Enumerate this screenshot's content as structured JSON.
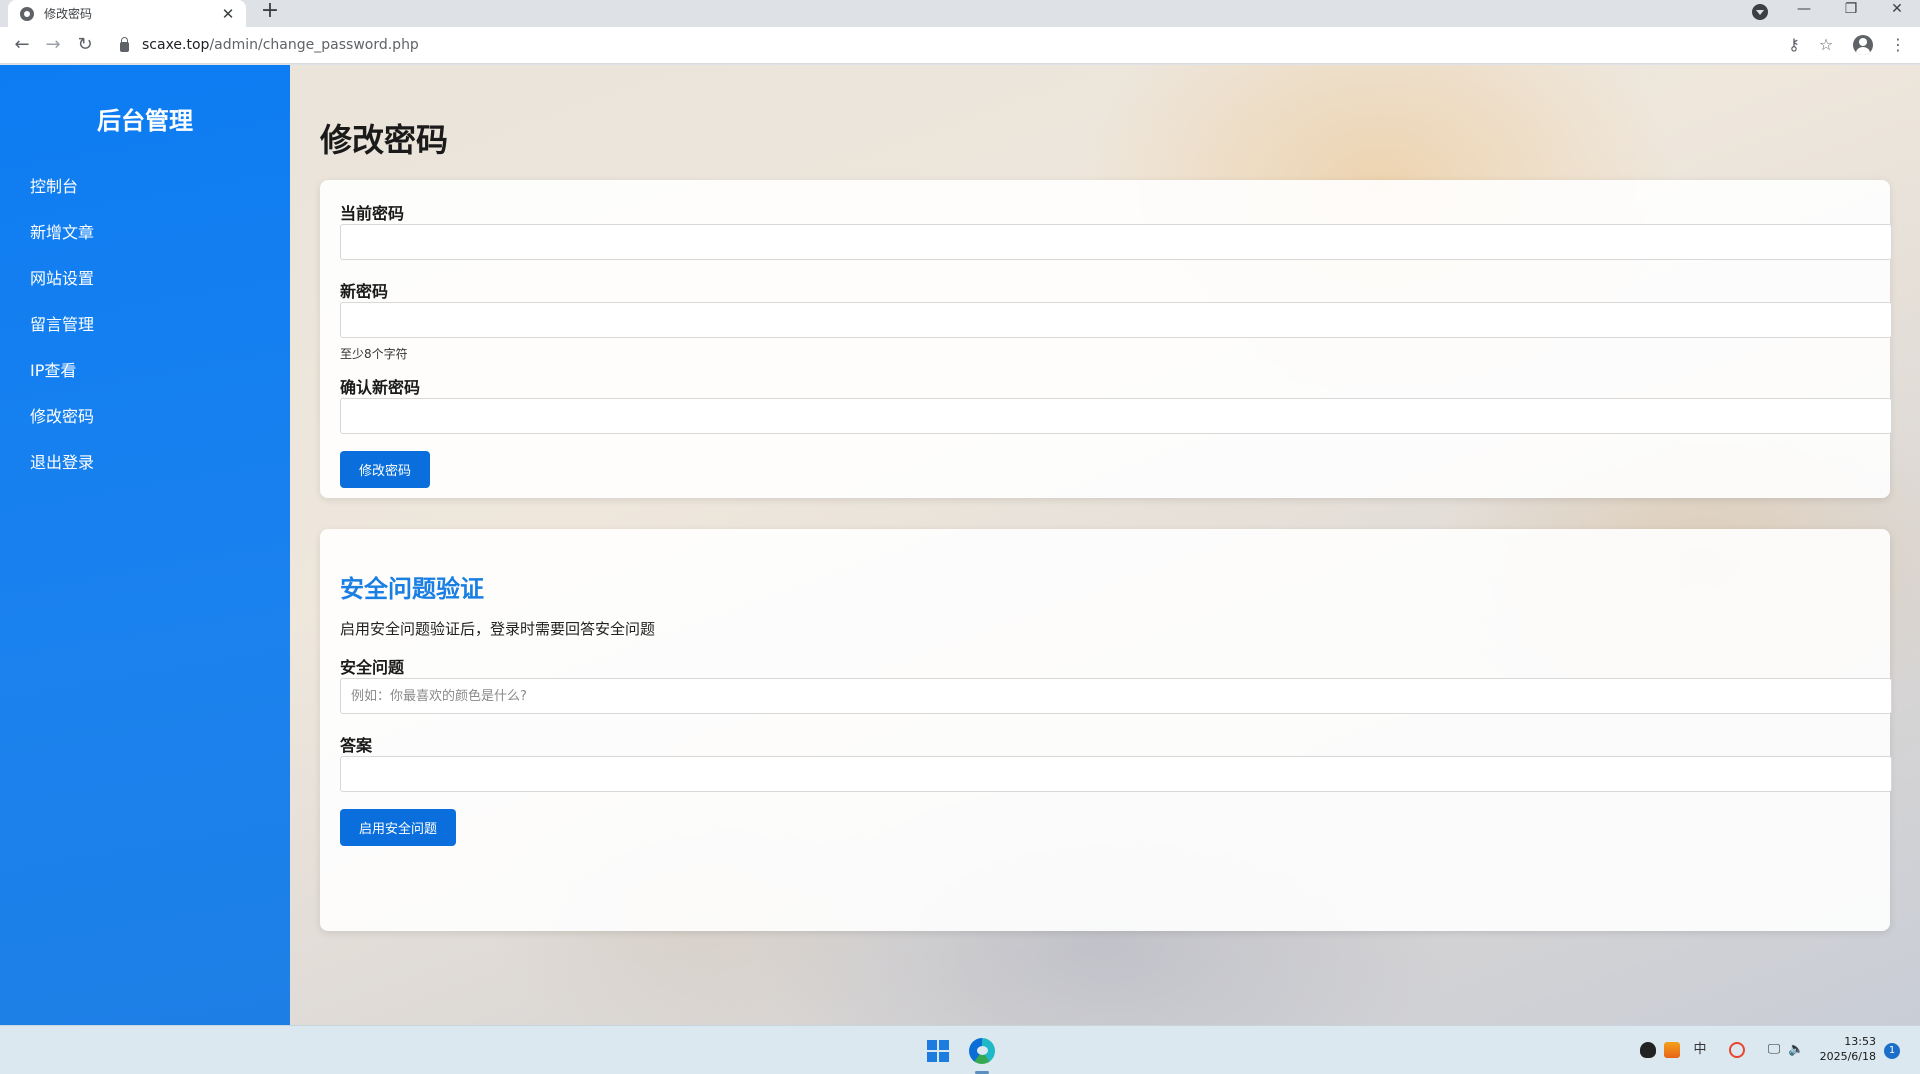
{
  "browser": {
    "tab_title": "修改密码",
    "tab_close": "✕",
    "new_tab": "+",
    "url_host": "scaxe.top",
    "url_path": "/admin/change_password.php",
    "win_minimize": "—",
    "win_restore": "❐",
    "win_close": "✕",
    "back": "←",
    "forward": "→",
    "reload": "↻",
    "key_glyph": "⚷",
    "star_glyph": "☆",
    "menu_glyph": "⋮"
  },
  "sidebar": {
    "title": "后台管理",
    "items": [
      {
        "label": "控制台"
      },
      {
        "label": "新增文章"
      },
      {
        "label": "网站设置"
      },
      {
        "label": "留言管理"
      },
      {
        "label": "IP查看"
      },
      {
        "label": "修改密码"
      },
      {
        "label": "退出登录"
      }
    ]
  },
  "main": {
    "page_title": "修改密码",
    "password_form": {
      "current_label": "当前密码",
      "current_value": "",
      "new_label": "新密码",
      "new_value": "",
      "new_hint": "至少8个字符",
      "confirm_label": "确认新密码",
      "confirm_value": "",
      "submit_label": "修改密码"
    },
    "security_form": {
      "title": "安全问题验证",
      "description": "启用安全问题验证后，登录时需要回答安全问题",
      "question_label": "安全问题",
      "question_placeholder": "例如：你最喜欢的颜色是什么?",
      "question_value": "",
      "answer_label": "答案",
      "answer_value": "",
      "submit_label": "启用安全问题"
    }
  },
  "taskbar": {
    "time": "13:53",
    "date": "2025/6/18",
    "notification_count": "1",
    "ime_glyph": "中",
    "volume_glyph": "🔈",
    "network_glyph": "🖵",
    "icons": [
      "windows-start-icon",
      "edge-icon",
      "qq-icon",
      "huorong-icon",
      "ime-icon",
      "sogou-icon",
      "network-icon",
      "volume-icon"
    ]
  },
  "colors": {
    "sidebar_bg": "#0d7cf2",
    "primary_button": "#0a6fdc",
    "section_title": "#1a7fe3"
  }
}
